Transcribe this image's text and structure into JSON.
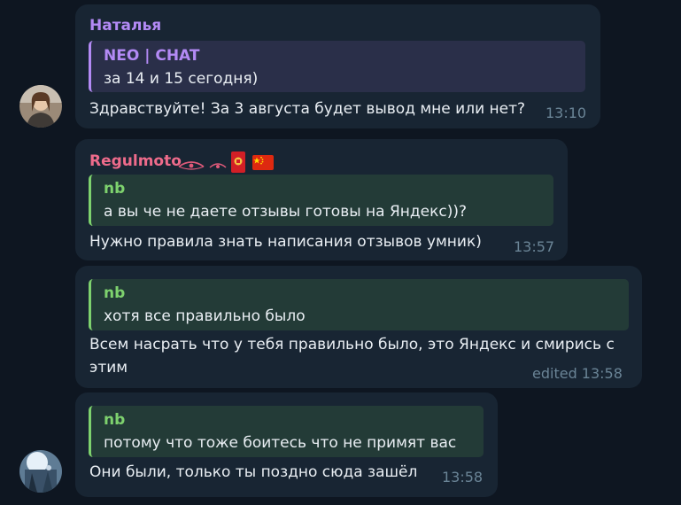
{
  "messages": [
    {
      "sender": "Наталья",
      "sender_color": "#b38af5",
      "reply": {
        "title": "NEO | CHAT",
        "text": "за 14 и 15 сегодня)",
        "color": "#b38af5"
      },
      "text": "Здравствуйте! За 3 августа будет вывод мне или нет?",
      "time": "13:10"
    },
    {
      "sender": "Regulmoto",
      "sender_color": "#ee6b8b",
      "sender_decor": [
        "eye-icon",
        "eye-icon",
        "red-envelope-icon",
        "china-flag-icon"
      ],
      "reply": {
        "title": "nb",
        "text": "а вы че не даете отзывы готовы на Яндекс))?",
        "color": "#7ed26e"
      },
      "text": "Нужно правила знать написания отзывов умник)",
      "time": "13:57"
    },
    {
      "reply": {
        "title": "nb",
        "text": "хотя все правильно было",
        "color": "#7ed26e"
      },
      "text_lines": [
        "Всем насрать что у тебя правильно было, это Яндекс и смирись с",
        "этим"
      ],
      "time": "edited 13:58"
    },
    {
      "reply": {
        "title": "nb",
        "text": "потому что тоже боитесь что не примят вас",
        "color": "#7ed26e"
      },
      "text": "Они были, только ты поздно сюда зашёл",
      "time": "13:58"
    }
  ]
}
